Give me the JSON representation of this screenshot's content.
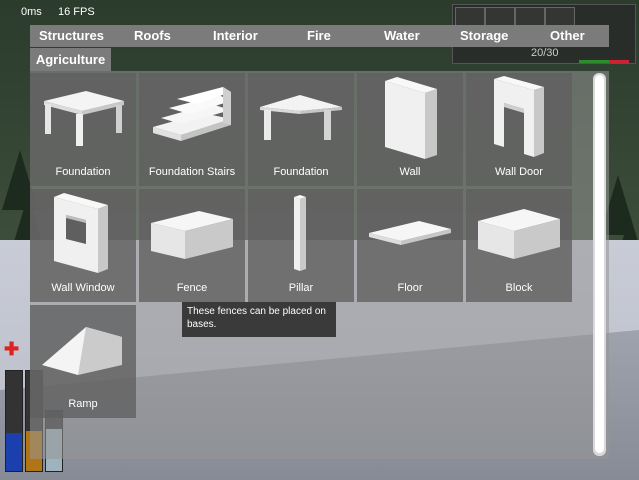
{
  "hud": {
    "ping": "0ms",
    "fps": "16 FPS",
    "hotbar_count": "20/30"
  },
  "tabs": [
    {
      "label": "Structures"
    },
    {
      "label": "Roofs"
    },
    {
      "label": "Interior"
    },
    {
      "label": "Fire"
    },
    {
      "label": "Water"
    },
    {
      "label": "Storage"
    },
    {
      "label": "Other"
    }
  ],
  "subtab": {
    "label": "Agriculture"
  },
  "items": [
    {
      "label": "Foundation",
      "icon": "table-foundation-icon"
    },
    {
      "label": "Foundation Stairs",
      "icon": "stairs-icon"
    },
    {
      "label": "Foundation",
      "icon": "roof-foundation-icon"
    },
    {
      "label": "Wall",
      "icon": "wall-icon"
    },
    {
      "label": "Wall Door",
      "icon": "wall-door-icon"
    },
    {
      "label": "Wall Window",
      "icon": "wall-window-icon"
    },
    {
      "label": "Fence",
      "icon": "fence-icon"
    },
    {
      "label": "Pillar",
      "icon": "pillar-icon"
    },
    {
      "label": "Floor",
      "icon": "floor-icon"
    },
    {
      "label": "Block",
      "icon": "block-icon"
    },
    {
      "label": "Ramp",
      "icon": "ramp-icon"
    }
  ],
  "tooltip": {
    "text": "These fences can be placed on bases."
  },
  "colors": {
    "panel": "#7b7b7b",
    "card": "#5f5f5f",
    "text": "#ffffff"
  }
}
